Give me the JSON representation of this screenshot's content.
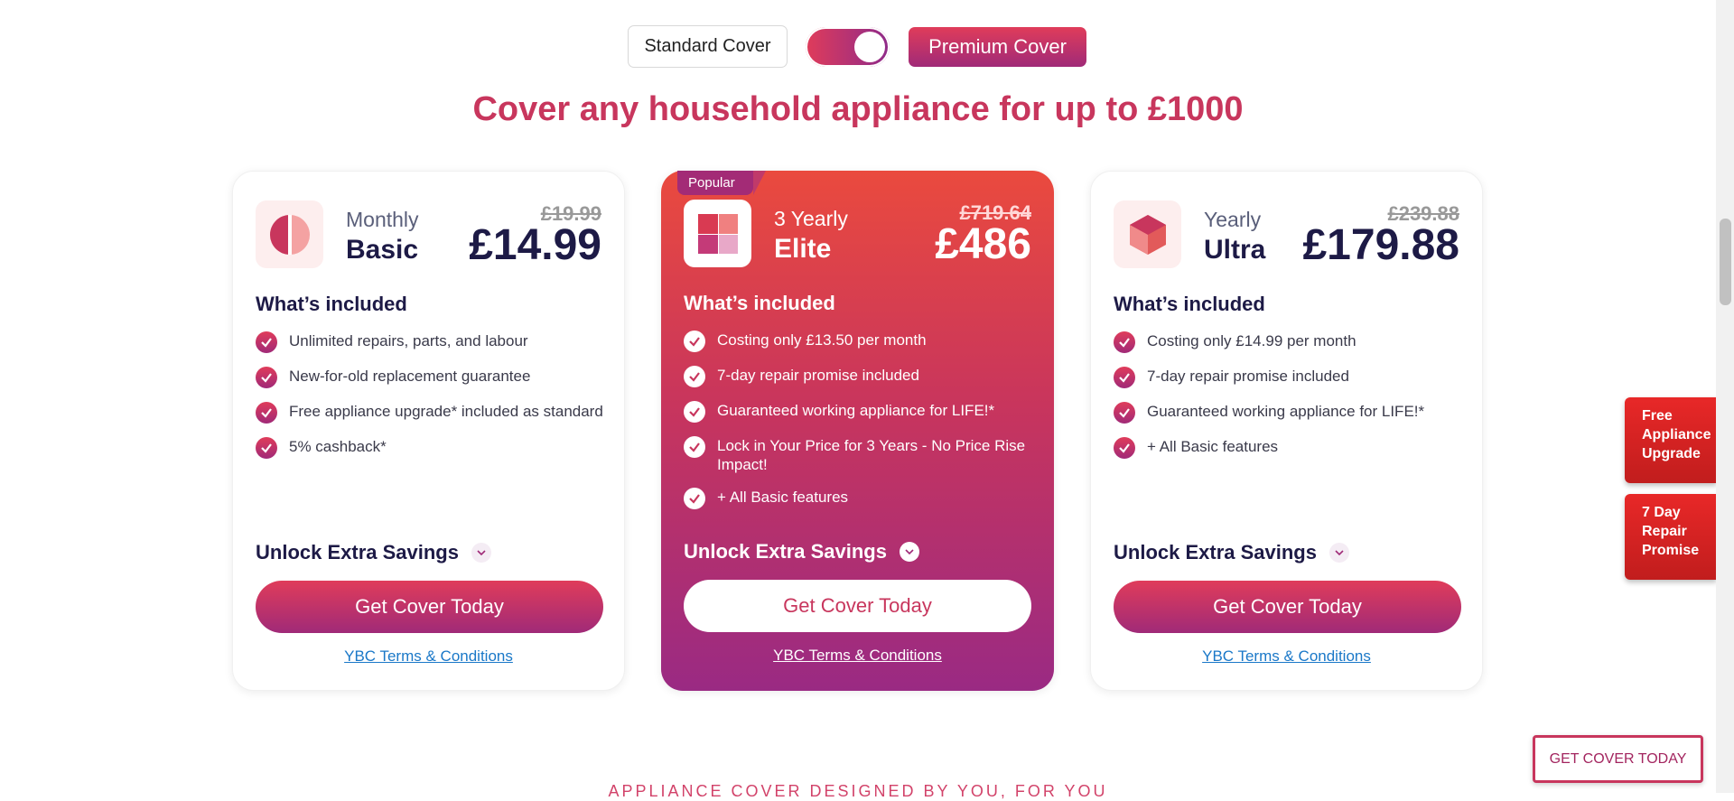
{
  "toggle": {
    "standard_label": "Standard Cover",
    "premium_label": "Premium Cover"
  },
  "headline": "Cover any household appliance for up to £1000",
  "plans": [
    {
      "period": "Monthly",
      "name": "Basic",
      "old_price": "£19.99",
      "price": "£14.99",
      "included_title": "What’s included",
      "features": [
        "Unlimited repairs, parts, and labour",
        "New-for-old replacement guarantee",
        "Free appliance upgrade* included as standard",
        "5% cashback*"
      ],
      "unlock": "Unlock Extra Savings",
      "cta": "Get Cover Today",
      "terms": "YBC Terms & Conditions"
    },
    {
      "badge": "Popular",
      "period": "3 Yearly",
      "name": "Elite",
      "old_price": "£719.64",
      "price": "£486",
      "included_title": "What’s included",
      "features": [
        "Costing only £13.50 per month",
        "7-day repair promise included",
        "Guaranteed working appliance for LIFE!*",
        "Lock in Your Price for 3 Years - No Price Rise Impact!",
        "+ All Basic features"
      ],
      "unlock": "Unlock Extra Savings",
      "cta": "Get Cover Today",
      "terms": "YBC Terms & Conditions"
    },
    {
      "period": "Yearly",
      "name": "Ultra",
      "old_price": "£239.88",
      "price": "£179.88",
      "included_title": "What’s included",
      "features": [
        "Costing only £14.99 per month",
        "7-day repair promise included",
        "Guaranteed working appliance for LIFE!*",
        "+ All Basic features"
      ],
      "unlock": "Unlock Extra Savings",
      "cta": "Get Cover Today",
      "terms": "YBC Terms & Conditions"
    }
  ],
  "ribbons": [
    "Free Appliance Upgrade",
    "7 Day Repair Promise"
  ],
  "floating_cta": "GET COVER TODAY",
  "bottom_caption": "APPLIANCE COVER DESIGNED BY YOU, FOR YOU",
  "colors": {
    "brand": "#c8365d",
    "navy": "#1d1a46",
    "link": "#1a78c8"
  }
}
